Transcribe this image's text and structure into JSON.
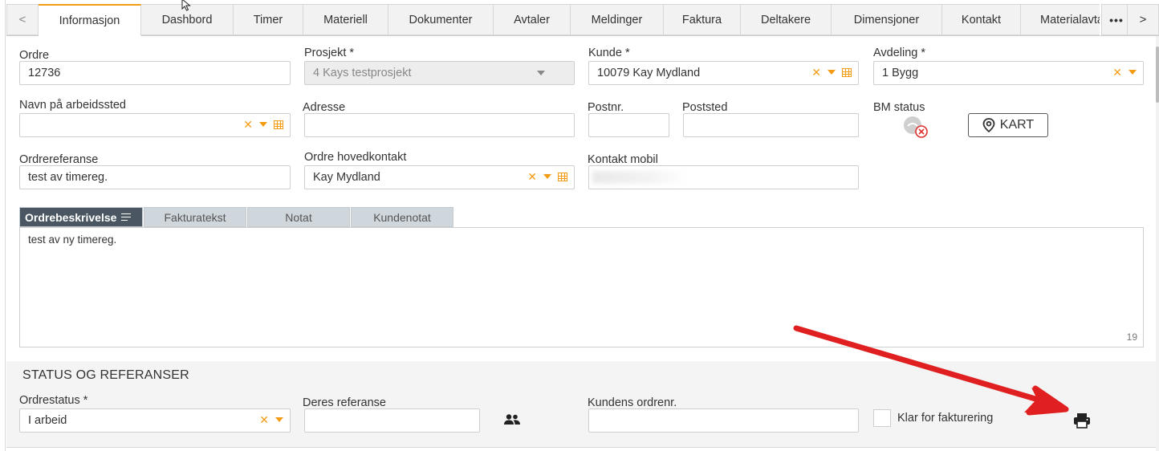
{
  "tabs": {
    "prev_glyph": "<",
    "next_glyph": ">",
    "more_glyph": "•••",
    "items": [
      {
        "label": "Informasjon",
        "active": true
      },
      {
        "label": "Dashbord"
      },
      {
        "label": "Timer"
      },
      {
        "label": "Materiell"
      },
      {
        "label": "Dokumenter"
      },
      {
        "label": "Avtaler"
      },
      {
        "label": "Meldinger"
      },
      {
        "label": "Faktura"
      },
      {
        "label": "Deltakere"
      },
      {
        "label": "Dimensjoner"
      },
      {
        "label": "Kontakt"
      },
      {
        "label": "Materialavtale"
      }
    ]
  },
  "form": {
    "ordre": {
      "label": "Ordre",
      "value": "12736"
    },
    "prosjekt": {
      "label": "Prosjekt *",
      "value": "4 Kays testprosjekt"
    },
    "kunde": {
      "label": "Kunde *",
      "value": "10079 Kay Mydland"
    },
    "avdeling": {
      "label": "Avdeling *",
      "value": "1 Bygg"
    },
    "navn_arbeidssted": {
      "label": "Navn på arbeidssted",
      "value": ""
    },
    "adresse": {
      "label": "Adresse",
      "value": ""
    },
    "postnr": {
      "label": "Postnr.",
      "value": ""
    },
    "poststed": {
      "label": "Poststed",
      "value": ""
    },
    "bm_status": {
      "label": "BM status"
    },
    "kart_button": "KART",
    "ordrereferanse": {
      "label": "Ordrereferanse",
      "value": "test av timereg."
    },
    "ordre_hovedkontakt": {
      "label": "Ordre hovedkontakt",
      "value": "Kay Mydland"
    },
    "kontakt_mobil": {
      "label": "Kontakt mobil",
      "value": ""
    }
  },
  "subtabs": [
    {
      "label": "Ordrebeskrivelse",
      "active": true
    },
    {
      "label": "Fakturatekst"
    },
    {
      "label": "Notat"
    },
    {
      "label": "Kundenotat"
    }
  ],
  "description": {
    "text": "test av ny timereg.",
    "char_count": "19"
  },
  "status_section": {
    "title": "STATUS OG REFERANSER",
    "ordrestatus": {
      "label": "Ordrestatus *",
      "value": "I arbeid"
    },
    "deres_referanse": {
      "label": "Deres referanse",
      "value": ""
    },
    "kundens_ordrenr": {
      "label": "Kundens ordrenr.",
      "value": ""
    },
    "klar_for_fakturering": {
      "label": "Klar for fakturering",
      "checked": false
    }
  },
  "colors": {
    "accent": "#f39c12",
    "subtab_active": "#4a5662",
    "annotation_arrow": "#e02020"
  },
  "icons": [
    "chevron-left-icon",
    "chevron-right-icon",
    "more-icon",
    "clear-icon",
    "dropdown-icon",
    "grid-lookup-icon",
    "location-pin-icon",
    "bm-status-icon",
    "lines-icon",
    "people-icon",
    "print-icon",
    "mouse-cursor-icon",
    "annotation-arrow"
  ]
}
